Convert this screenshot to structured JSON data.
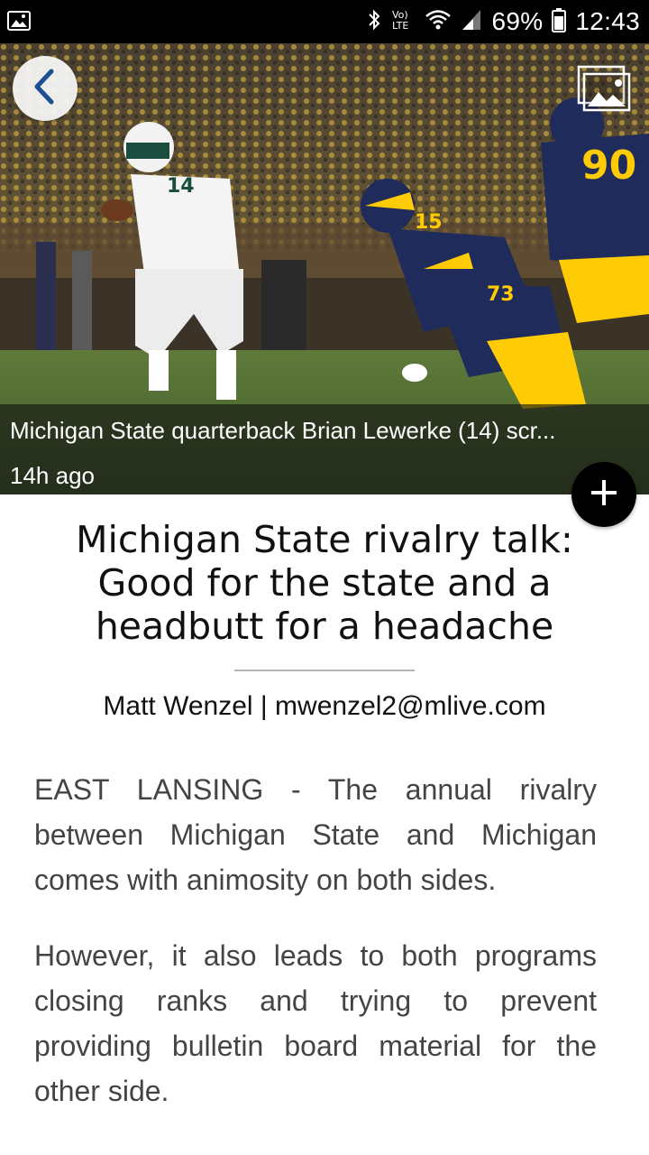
{
  "status_bar": {
    "battery_percent": "69%",
    "time": "12:43",
    "network_label": "Vo) LTE"
  },
  "hero": {
    "caption": "Michigan State quarterback Brian Lewerke (14) scr...",
    "timestamp": "14h ago",
    "jersey_numbers": [
      "14",
      "15",
      "73",
      "90"
    ]
  },
  "article": {
    "title": "Michigan State rivalry talk: Good for the state and a headbutt for a headache",
    "byline": "Matt Wenzel | mwenzel2@mlive.com",
    "paragraphs": [
      "EAST LANSING - The annual rivalry between Michigan State and Michigan comes with animosity on both sides.",
      "However, it also leads to both programs closing ranks and trying to prevent providing bulletin board material for the other side."
    ]
  },
  "colors": {
    "status_bar_bg": "#000000",
    "msu_green": "#1b4d3e",
    "michigan_maize": "#ffcb05",
    "michigan_blue": "#1f2b5b"
  }
}
